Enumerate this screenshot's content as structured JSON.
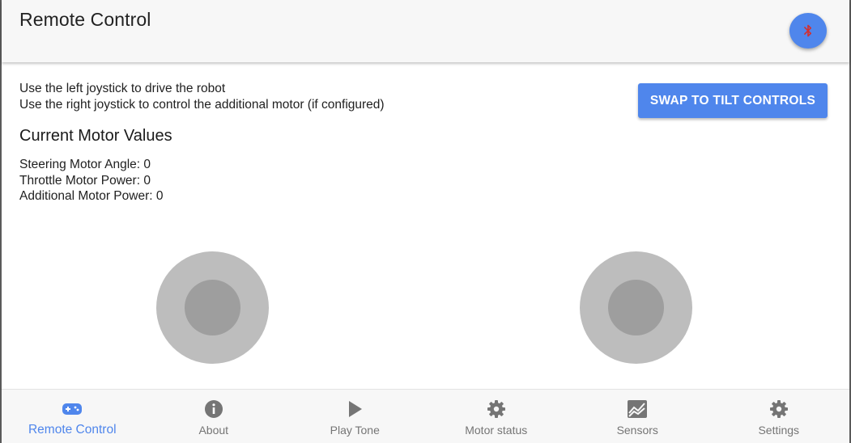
{
  "app_bar": {
    "title": "Remote Control",
    "bluetooth_button": {
      "icon": "bluetooth-icon",
      "icon_color": "#d32f2f",
      "background": "#4f86ec"
    }
  },
  "instructions": {
    "line1": "Use the left joystick to drive the robot",
    "line2": "Use the right joystick to control the additional motor (if configured)"
  },
  "swap_button": {
    "label": "SWAP TO TILT CONTROLS"
  },
  "motor_values": {
    "heading": "Current Motor Values",
    "steering": "Steering Motor Angle: 0",
    "throttle": "Throttle Motor Power: 0",
    "additional": "Additional Motor Power: 0"
  },
  "joysticks": {
    "left": {
      "name": "left-joystick"
    },
    "right": {
      "name": "right-joystick"
    }
  },
  "bottom_nav": {
    "active_color": "#4f86ec",
    "inactive_color": "#757575",
    "items": [
      {
        "label": "Remote Control",
        "icon": "gamepad-icon",
        "active": true
      },
      {
        "label": "About",
        "icon": "info-icon",
        "active": false
      },
      {
        "label": "Play Tone",
        "icon": "play-icon",
        "active": false
      },
      {
        "label": "Motor status",
        "icon": "gear-icon",
        "active": false
      },
      {
        "label": "Sensors",
        "icon": "chart-icon",
        "active": false
      },
      {
        "label": "Settings",
        "icon": "gear-icon",
        "active": false
      }
    ]
  }
}
